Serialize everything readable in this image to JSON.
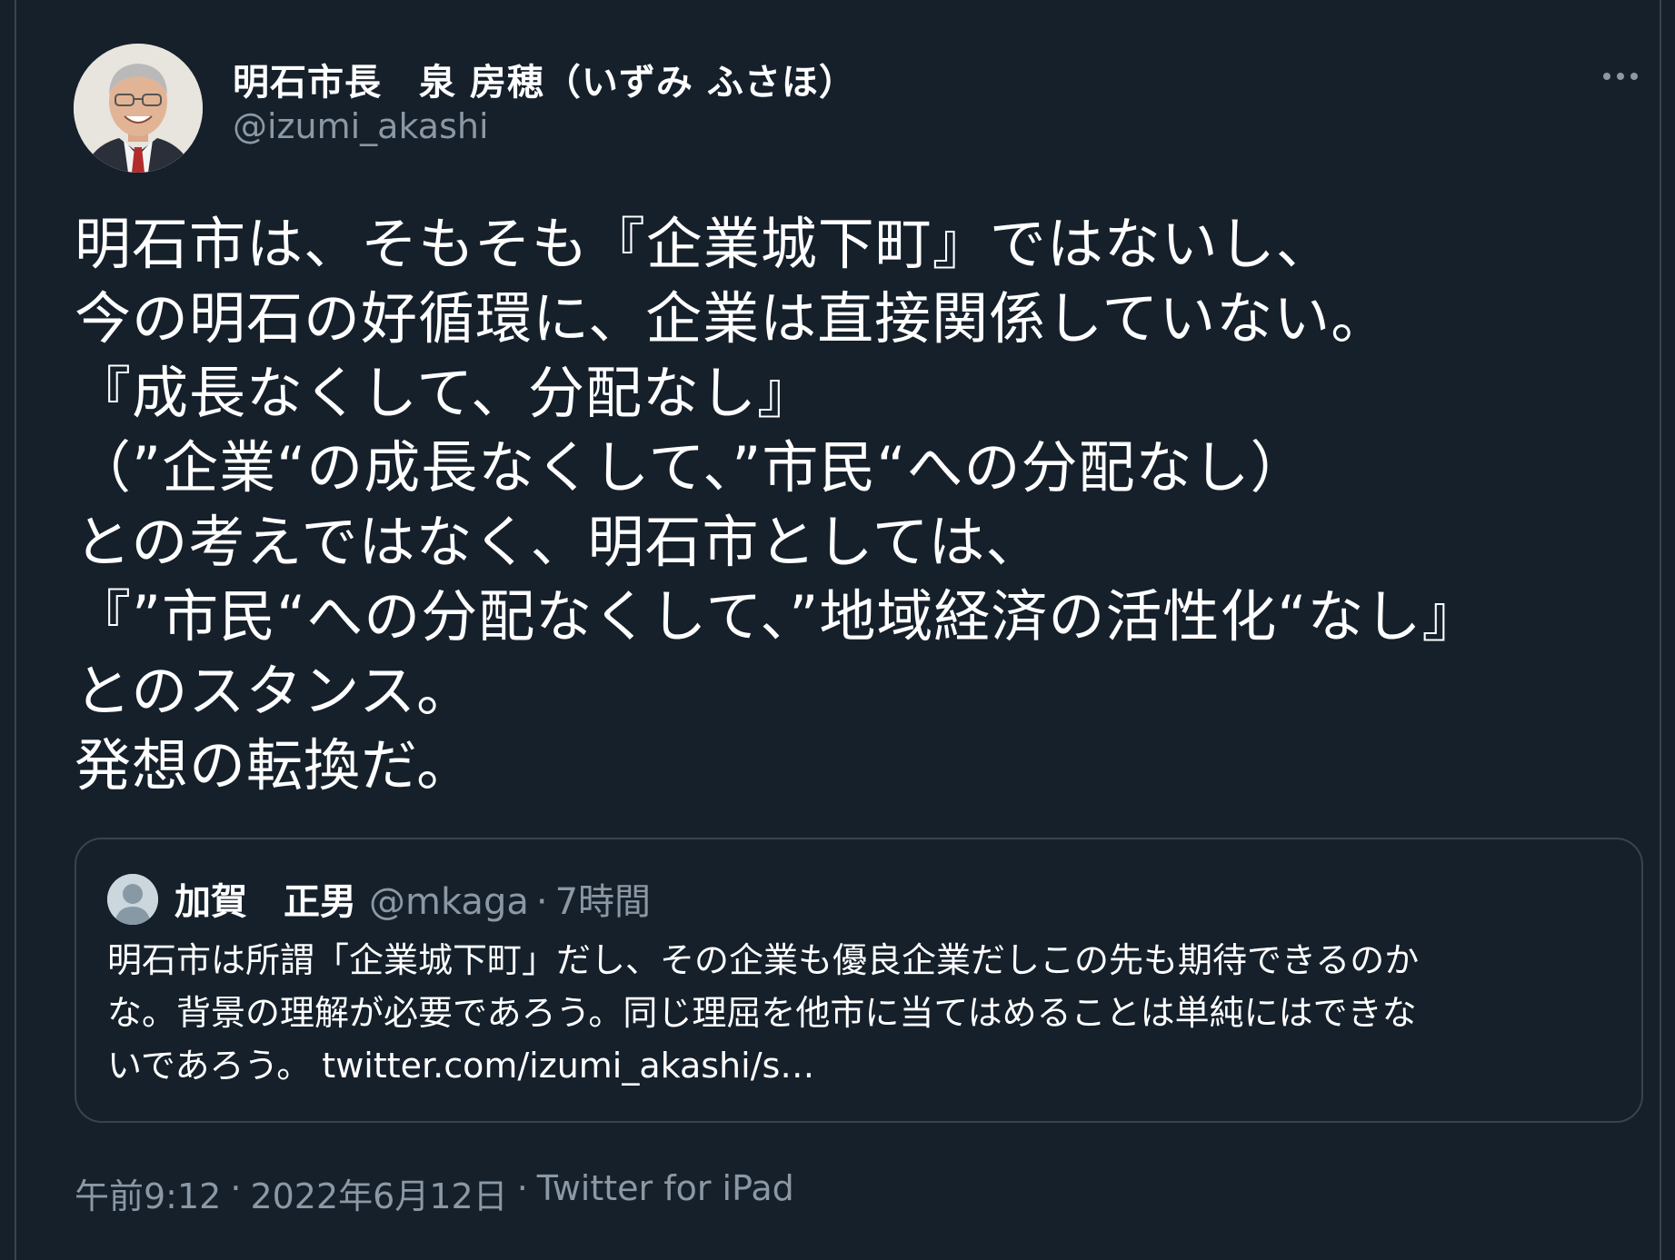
{
  "author": {
    "display_name": "明石市長　泉 房穂（いずみ ふさほ）",
    "handle": "@izumi_akashi"
  },
  "tweet": {
    "lines": [
      "明石市は、そもそも『企業城下町』ではないし、",
      "今の明石の好循環に、企業は直接関係していない。",
      "『成長なくして、分配なし』",
      "（”企業“の成長なくして、”市民“への分配なし）",
      "との考えではなく、明石市としては、",
      "『”市民“への分配なくして、”地域経済の活性化“なし』",
      "とのスタンス。",
      "発想の転換だ。"
    ]
  },
  "quoted_tweet": {
    "name": "加賀　正男",
    "handle": "@mkaga",
    "separator": "·",
    "time": "7時間",
    "body_lines": [
      "明石市は所謂「企業城下町」だし、その企業も優良企業だしこの先も期待できるのか",
      "な。背景の理解が必要であろう。同じ理屈を他市に当てはめることは単純にはできな",
      "いであろう。"
    ],
    "link": "twitter.com/izumi_akashi/s…"
  },
  "meta": {
    "time": "午前9:12",
    "separator": "·",
    "date": "2022年6月12日",
    "source": "Twitter for iPad"
  },
  "icons": {
    "more": "more-horizontal-icon",
    "avatar": "avatar-photo",
    "quote_avatar": "default-avatar-icon"
  },
  "colors": {
    "background": "#15202b",
    "border": "#38444d",
    "secondary_text": "#8b98a5"
  }
}
